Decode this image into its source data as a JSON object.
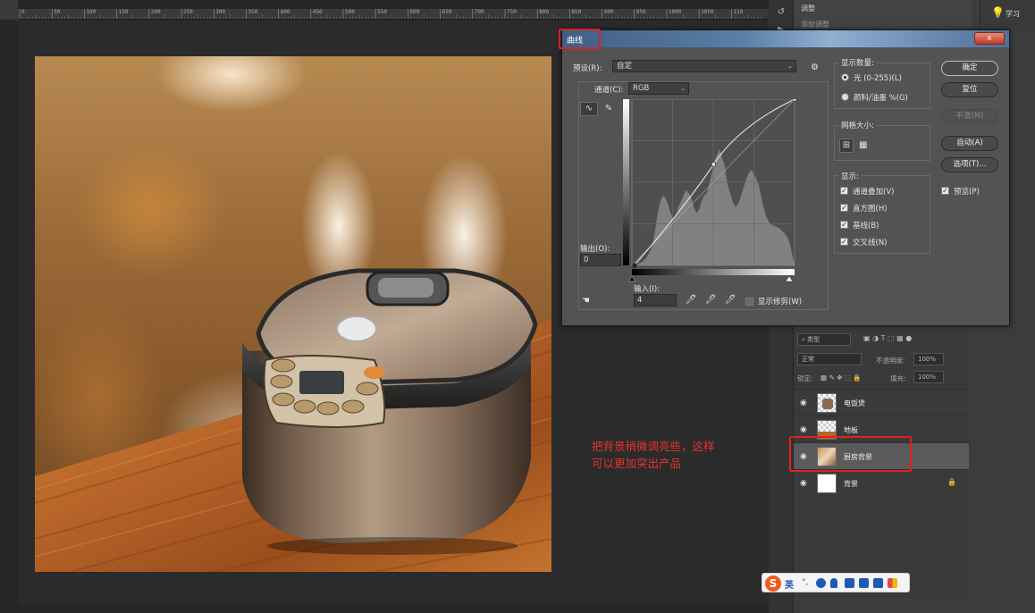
{
  "ruler": {
    "ticks": [
      "0",
      "50",
      "100",
      "150",
      "200",
      "250",
      "300",
      "350",
      "400",
      "450",
      "500",
      "550",
      "600",
      "650",
      "700",
      "750",
      "800",
      "850",
      "900",
      "950",
      "1000",
      "1050",
      "110"
    ]
  },
  "panels": {
    "properties_tab": "调整",
    "properties_sub": "添加调整",
    "learn_label": "学习"
  },
  "curves": {
    "title": "曲线",
    "close": "x",
    "preset_label": "预设(R):",
    "preset_value": "自定",
    "channel_label": "通道(C):",
    "channel_value": "RGB",
    "output_label": "输出(O):",
    "output_value": "0",
    "input_label": "输入(I):",
    "input_value": "4",
    "show_clipping": "显示修剪(W)",
    "display_amount_title": "显示数量:",
    "light_option": "光 (0-255)(L)",
    "pigment_option": "颜料/油墨 %(G)",
    "grid_size_title": "网格大小:",
    "show_title": "显示:",
    "show_channel_overlays": "通道叠加(V)",
    "show_histogram": "直方图(H)",
    "show_baseline": "基线(B)",
    "show_intersection": "交叉线(N)",
    "buttons": {
      "ok": "确定",
      "reset": "复位",
      "smooth": "平滑(M)",
      "auto": "自动(A)",
      "options": "选项(T)..."
    },
    "preview_label": "预览(P)",
    "curve_points": [
      [
        4,
        0
      ],
      [
        128,
        155
      ],
      [
        255,
        255
      ]
    ]
  },
  "layers": {
    "filter_kind": "类型",
    "blend_mode": "正常",
    "opacity_label": "不透明度:",
    "opacity_value": "100%",
    "lock_label": "锁定:",
    "fill_label": "填充:",
    "fill_value": "100%",
    "items": [
      {
        "name": "电饭煲",
        "selected": false,
        "locked": false
      },
      {
        "name": "地板",
        "selected": false,
        "locked": false
      },
      {
        "name": "厨房背景",
        "selected": true,
        "locked": false
      },
      {
        "name": "背景",
        "selected": false,
        "locked": true
      }
    ]
  },
  "annotation": {
    "line1": "把背景稍微调亮些，这样",
    "line2": "可以更加突出产品"
  },
  "ime": {
    "logo": "S",
    "mode": "英"
  },
  "colors": {
    "highlight": "#e02020",
    "annotation": "#e8332c"
  }
}
